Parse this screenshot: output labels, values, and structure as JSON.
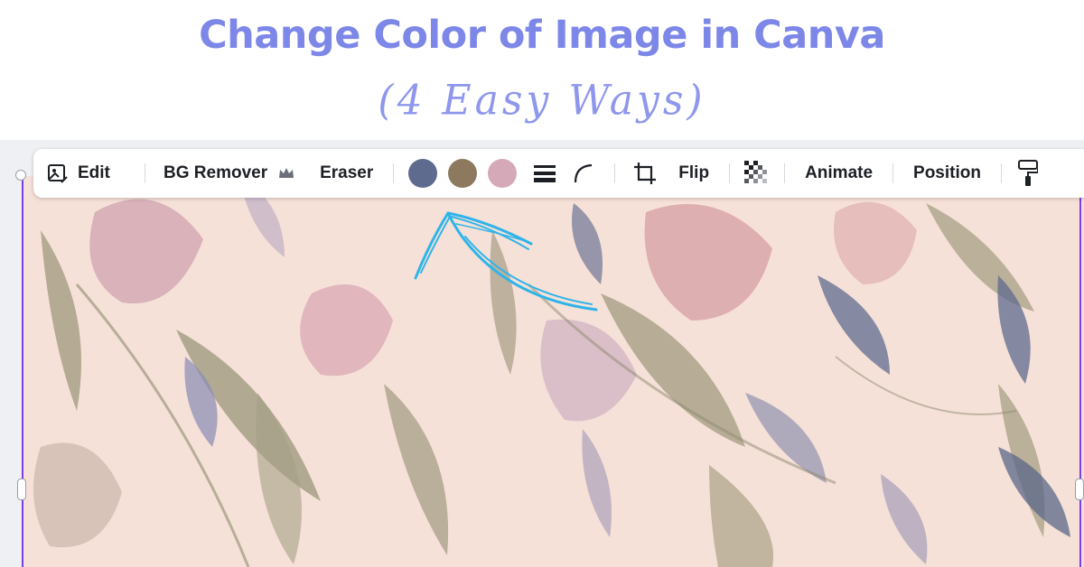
{
  "header": {
    "title": "Change Color of Image in Canva",
    "subtitle": "(4 Easy Ways)"
  },
  "toolbar": {
    "edit_label": "Edit",
    "bg_remover_label": "BG Remover",
    "eraser_label": "Eraser",
    "flip_label": "Flip",
    "animate_label": "Animate",
    "position_label": "Position",
    "colors": [
      "#5e6b8e",
      "#8d7a5e",
      "#d6a9b8"
    ]
  },
  "theme": {
    "title_color": "#7d87e8",
    "arrow_color": "#2fb4ea",
    "selection_color": "#7b3fe4",
    "image_background": "#f6e1d8"
  },
  "icons": [
    "edit-image-icon",
    "crown-icon",
    "border-style-icon",
    "corner-rounding-icon",
    "crop-icon",
    "transparency-icon",
    "copy-style-icon"
  ]
}
